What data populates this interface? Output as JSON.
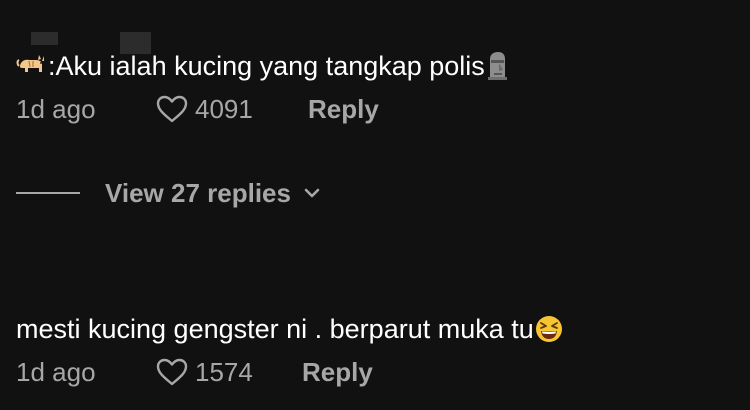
{
  "comments": [
    {
      "prefix": ":",
      "text": " Aku ialah kucing yang tangkap polis",
      "time": "1d ago",
      "likes": "4091",
      "reply_label": "Reply"
    },
    {
      "text": "mesti kucing gengster ni . berparut muka tu ",
      "time": "1d ago",
      "likes": "1574",
      "reply_label": "Reply"
    }
  ],
  "view_replies": {
    "label": "View 27 replies"
  },
  "colors": {
    "background": "#111111",
    "text": "#ffffff",
    "muted": "#a7a7a7"
  },
  "icons": [
    "cat-emoji-icon",
    "moai-emoji-icon",
    "laughing-emoji-icon",
    "heart-outline-icon",
    "chevron-down-icon"
  ]
}
